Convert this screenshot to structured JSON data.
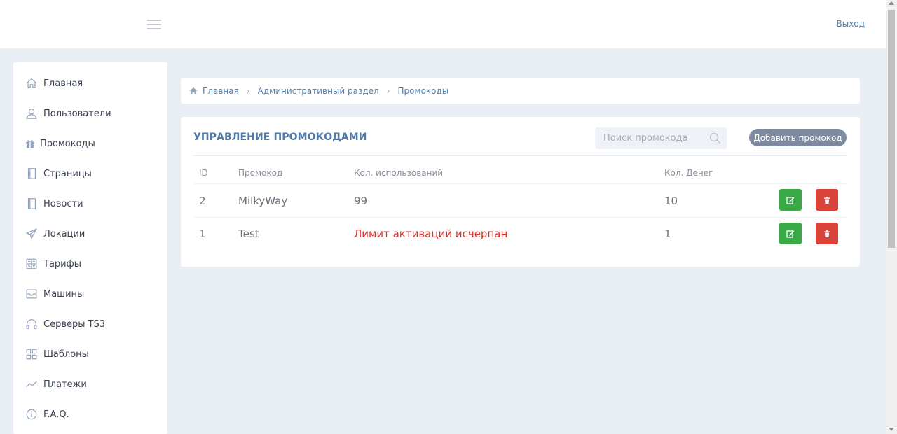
{
  "header": {
    "logout_label": "Выход"
  },
  "sidebar": {
    "items": [
      {
        "label": "Главная",
        "icon": "home-icon"
      },
      {
        "label": "Пользователи",
        "icon": "user-icon"
      },
      {
        "label": "Промокоды",
        "icon": "gift-icon"
      },
      {
        "label": "Страницы",
        "icon": "notebook-icon"
      },
      {
        "label": "Новости",
        "icon": "notebook-icon"
      },
      {
        "label": "Локации",
        "icon": "plane-icon"
      },
      {
        "label": "Тарифы",
        "icon": "calculator-icon"
      },
      {
        "label": "Машины",
        "icon": "inbox-icon"
      },
      {
        "label": "Серверы TS3",
        "icon": "headphones-icon"
      },
      {
        "label": "Шаблоны",
        "icon": "grid-icon"
      },
      {
        "label": "Платежи",
        "icon": "chart-line-icon"
      },
      {
        "label": "F.A.Q.",
        "icon": "info-icon"
      }
    ]
  },
  "breadcrumb": {
    "items": [
      "Главная",
      "Административный раздел",
      "Промокоды"
    ]
  },
  "panel": {
    "title": "УПРАВЛЕНИЕ ПРОМОКОДАМИ",
    "search_placeholder": "Поиск промокода",
    "add_button_label": "Добавить промокод",
    "columns": [
      "ID",
      "Промокод",
      "Кол. использований",
      "Кол. Денег"
    ],
    "rows": [
      {
        "id": "2",
        "code": "MilkyWay",
        "uses": "99",
        "money": "10",
        "uses_exhausted": false
      },
      {
        "id": "1",
        "code": "Test",
        "uses": "Лимит активаций исчерпан",
        "money": "1",
        "uses_exhausted": true
      }
    ]
  },
  "colors": {
    "accent": "#4f81b3",
    "edit_button": "#3aa844",
    "delete_button": "#d9433a",
    "limit_text": "#e0302a",
    "add_button": "#7e8aa0"
  }
}
